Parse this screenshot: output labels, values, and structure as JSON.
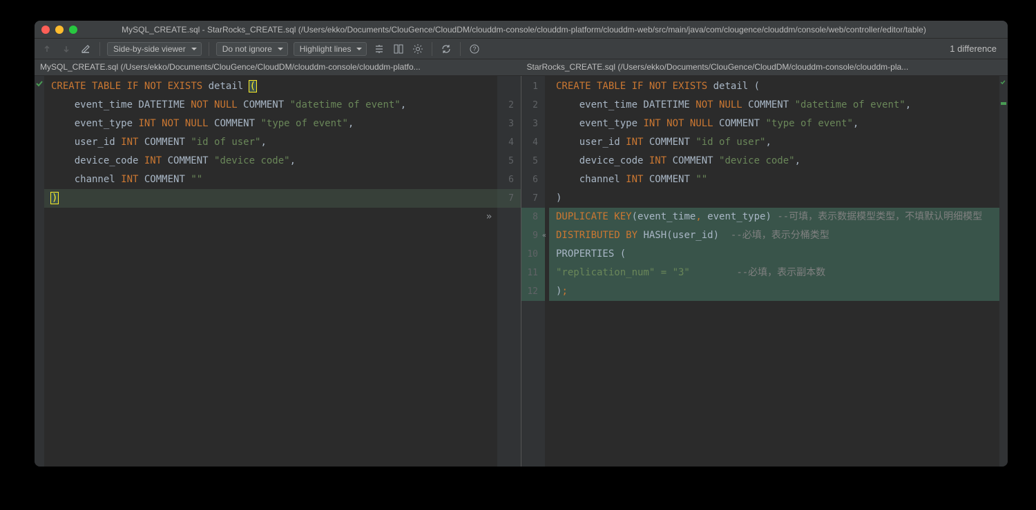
{
  "title": "MySQL_CREATE.sql - StarRocks_CREATE.sql (/Users/ekko/Documents/ClouGence/CloudDM/clouddm-console/clouddm-platform/clouddm-web/src/main/java/com/clougence/clouddm/console/web/controller/editor/table)",
  "toolbar": {
    "viewer_mode": "Side-by-side viewer",
    "ignore_mode": "Do not ignore",
    "highlight_mode": "Highlight lines",
    "diff_count": "1 difference"
  },
  "left": {
    "header": "MySQL_CREATE.sql (/Users/ekko/Documents/ClouGence/CloudDM/clouddm-console/clouddm-platfo...",
    "line_numbers": [
      "",
      "2",
      "3",
      "4",
      "5",
      "6",
      "7"
    ],
    "lines": [
      {
        "tokens": [
          {
            "t": "CREATE TABLE",
            "c": "kw"
          },
          {
            "t": " ",
            "c": "ident"
          },
          {
            "t": "IF",
            "c": "kw"
          },
          {
            "t": " ",
            "c": "ident"
          },
          {
            "t": "NOT EXISTS",
            "c": "kw"
          },
          {
            "t": " detail ",
            "c": "ident"
          },
          {
            "t": "(",
            "c": "hl-bracket"
          }
        ]
      },
      {
        "tokens": [
          {
            "t": "    event_time DATETIME ",
            "c": "ident"
          },
          {
            "t": "NOT NULL",
            "c": "kw"
          },
          {
            "t": " COMMENT ",
            "c": "ident"
          },
          {
            "t": "\"datetime of event\"",
            "c": "str"
          },
          {
            "t": ",",
            "c": "ident"
          }
        ]
      },
      {
        "tokens": [
          {
            "t": "    event_type ",
            "c": "ident"
          },
          {
            "t": "INT",
            "c": "num-ty"
          },
          {
            "t": " ",
            "c": "ident"
          },
          {
            "t": "NOT NULL",
            "c": "kw"
          },
          {
            "t": " COMMENT ",
            "c": "ident"
          },
          {
            "t": "\"type of event\"",
            "c": "str"
          },
          {
            "t": ",",
            "c": "ident"
          }
        ]
      },
      {
        "tokens": [
          {
            "t": "    user_id ",
            "c": "ident"
          },
          {
            "t": "INT",
            "c": "num-ty"
          },
          {
            "t": " COMMENT ",
            "c": "ident"
          },
          {
            "t": "\"id of user\"",
            "c": "str"
          },
          {
            "t": ",",
            "c": "ident"
          }
        ]
      },
      {
        "tokens": [
          {
            "t": "    device_code ",
            "c": "ident"
          },
          {
            "t": "INT",
            "c": "num-ty"
          },
          {
            "t": " COMMENT ",
            "c": "ident"
          },
          {
            "t": "\"device code\"",
            "c": "str"
          },
          {
            "t": ",",
            "c": "ident"
          }
        ]
      },
      {
        "tokens": [
          {
            "t": "    channel ",
            "c": "ident"
          },
          {
            "t": "INT",
            "c": "num-ty"
          },
          {
            "t": " COMMENT ",
            "c": "ident"
          },
          {
            "t": "\"\"",
            "c": "str"
          }
        ]
      },
      {
        "tokens": [
          {
            "t": ")",
            "c": "hl-bracket"
          }
        ],
        "changed": true
      }
    ]
  },
  "right": {
    "header": "StarRocks_CREATE.sql (/Users/ekko/Documents/ClouGence/CloudDM/clouddm-console/clouddm-pla...",
    "line_numbers": [
      "1",
      "2",
      "3",
      "4",
      "5",
      "6",
      "7",
      "8",
      "9",
      "10",
      "11",
      "12"
    ],
    "lines": [
      {
        "tokens": [
          {
            "t": "CREATE TABLE",
            "c": "kw"
          },
          {
            "t": " ",
            "c": "ident"
          },
          {
            "t": "IF",
            "c": "kw"
          },
          {
            "t": " ",
            "c": "ident"
          },
          {
            "t": "NOT EXISTS",
            "c": "kw"
          },
          {
            "t": " detail (",
            "c": "ident"
          }
        ]
      },
      {
        "tokens": [
          {
            "t": "    event_time DATETIME ",
            "c": "ident"
          },
          {
            "t": "NOT NULL",
            "c": "kw"
          },
          {
            "t": " COMMENT ",
            "c": "ident"
          },
          {
            "t": "\"datetime of event\"",
            "c": "str"
          },
          {
            "t": ",",
            "c": "ident"
          }
        ]
      },
      {
        "tokens": [
          {
            "t": "    event_type ",
            "c": "ident"
          },
          {
            "t": "INT",
            "c": "num-ty"
          },
          {
            "t": " ",
            "c": "ident"
          },
          {
            "t": "NOT NULL",
            "c": "kw"
          },
          {
            "t": " COMMENT ",
            "c": "ident"
          },
          {
            "t": "\"type of event\"",
            "c": "str"
          },
          {
            "t": ",",
            "c": "ident"
          }
        ]
      },
      {
        "tokens": [
          {
            "t": "    user_id ",
            "c": "ident"
          },
          {
            "t": "INT",
            "c": "num-ty"
          },
          {
            "t": " COMMENT ",
            "c": "ident"
          },
          {
            "t": "\"id of user\"",
            "c": "str"
          },
          {
            "t": ",",
            "c": "ident"
          }
        ]
      },
      {
        "tokens": [
          {
            "t": "    device_code ",
            "c": "ident"
          },
          {
            "t": "INT",
            "c": "num-ty"
          },
          {
            "t": " COMMENT ",
            "c": "ident"
          },
          {
            "t": "\"device code\"",
            "c": "str"
          },
          {
            "t": ",",
            "c": "ident"
          }
        ]
      },
      {
        "tokens": [
          {
            "t": "    channel ",
            "c": "ident"
          },
          {
            "t": "INT",
            "c": "num-ty"
          },
          {
            "t": " COMMENT ",
            "c": "ident"
          },
          {
            "t": "\"\"",
            "c": "str"
          }
        ]
      },
      {
        "tokens": [
          {
            "t": ")",
            "c": "ident"
          }
        ]
      },
      {
        "tokens": [
          {
            "t": "DUPLICATE",
            "c": "kw"
          },
          {
            "t": " ",
            "c": "ident"
          },
          {
            "t": "KEY",
            "c": "kw"
          },
          {
            "t": "(event_time",
            "c": "ident"
          },
          {
            "t": ",",
            "c": "kw"
          },
          {
            "t": " event_type) ",
            "c": "ident"
          },
          {
            "t": "--可填，表示数据模型类型，不填默认明细模型",
            "c": "comment"
          }
        ],
        "added": true
      },
      {
        "tokens": [
          {
            "t": "DISTRIBUTED",
            "c": "kw"
          },
          {
            "t": " ",
            "c": "ident"
          },
          {
            "t": "BY",
            "c": "kw"
          },
          {
            "t": " HASH(user_id)  ",
            "c": "ident"
          },
          {
            "t": "--必填，表示分桶类型",
            "c": "comment"
          }
        ],
        "added": true
      },
      {
        "tokens": [
          {
            "t": "PROPERTIES (",
            "c": "ident"
          }
        ],
        "added": true
      },
      {
        "tokens": [
          {
            "t": "\"replication_num\" = \"3\"",
            "c": "str"
          },
          {
            "t": "        ",
            "c": "ident"
          },
          {
            "t": "--必填，表示副本数",
            "c": "comment"
          }
        ],
        "added": true
      },
      {
        "tokens": [
          {
            "t": ")",
            "c": "ident"
          },
          {
            "t": ";",
            "c": "kw"
          }
        ],
        "added": true
      }
    ]
  }
}
